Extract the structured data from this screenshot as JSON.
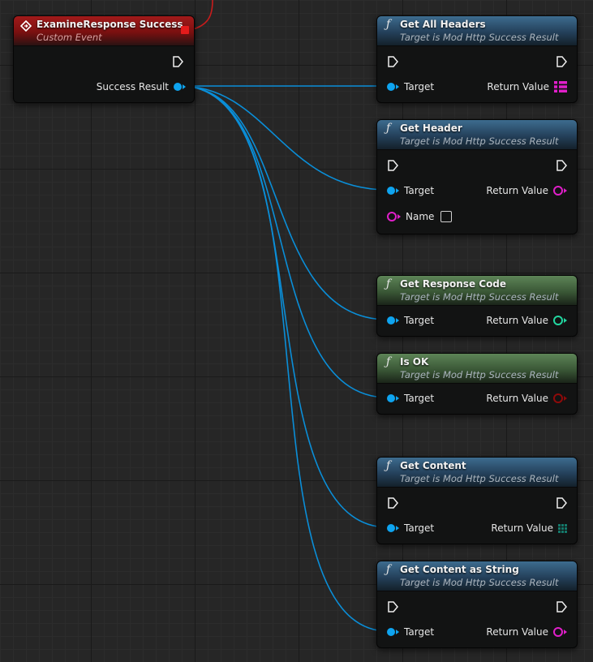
{
  "event_node": {
    "title": "ExamineResponse Success",
    "subtitle": "Custom Event",
    "output_label": "Success Result"
  },
  "function_nodes": [
    {
      "title": "Get All Headers",
      "subtitle": "Target is Mod Http Success Result",
      "target_label": "Target",
      "return_label": "Return Value",
      "return_type_icon": "map-grid-icon",
      "return_color": "#e01fc9"
    },
    {
      "title": "Get Header",
      "subtitle": "Target is Mod Http Success Result",
      "target_label": "Target",
      "return_label": "Return Value",
      "extra_input_label": "Name",
      "return_type_icon": "string-ring-icon",
      "return_color": "#e01fc9"
    },
    {
      "title": "Get Response Code",
      "subtitle": "Target is Mod Http Success Result",
      "target_label": "Target",
      "return_label": "Return Value",
      "return_type_icon": "integer-ring-icon",
      "return_color": "#22d6a0"
    },
    {
      "title": "Is OK",
      "subtitle": "Target is Mod Http Success Result",
      "target_label": "Target",
      "return_label": "Return Value",
      "return_type_icon": "boolean-ring-icon",
      "return_color": "#8e0a0a"
    },
    {
      "title": "Get Content",
      "subtitle": "Target is Mod Http Success Result",
      "target_label": "Target",
      "return_label": "Return Value",
      "return_type_icon": "byte-array-grid-icon",
      "return_color": "#14786a"
    },
    {
      "title": "Get Content as String",
      "subtitle": "Target is Mod Http Success Result",
      "target_label": "Target",
      "return_label": "Return Value",
      "return_type_icon": "string-ring-icon",
      "return_color": "#e01fc9"
    }
  ],
  "colors": {
    "wire_object": "#0a8ed8",
    "wire_exec_red": "#c81c1c",
    "event_header": "#a21a1a",
    "function_header_blue": "#3d6c8f",
    "pure_header_green": "#5d8457"
  }
}
